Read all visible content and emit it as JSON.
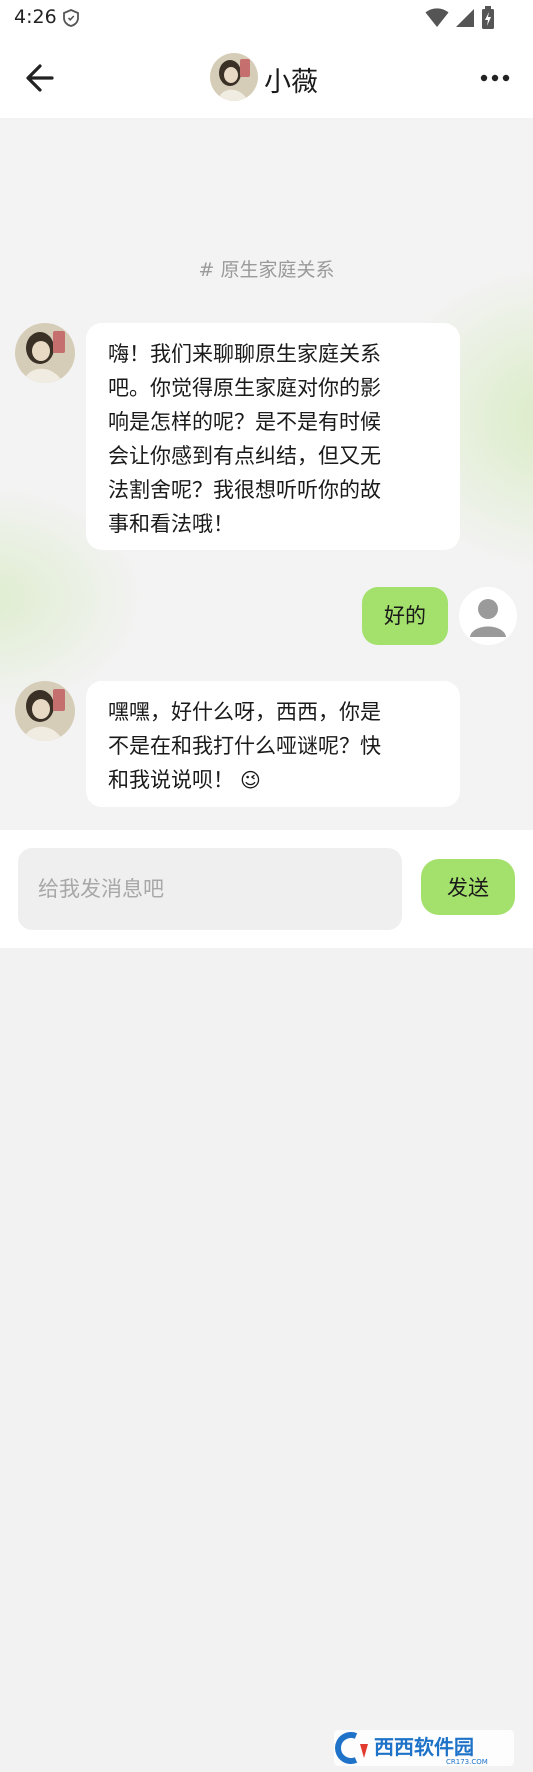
{
  "status_bar": {
    "time": "4:26",
    "icons": [
      "shield-icon",
      "wifi-icon",
      "signal-icon",
      "battery-charging-icon"
    ]
  },
  "header": {
    "back_icon": "arrow-left-icon",
    "title": "小薇",
    "more_icon": "more-horizontal-icon"
  },
  "chat": {
    "topic": "# 原生家庭关系",
    "messages": [
      {
        "sender": "小薇",
        "side": "left",
        "text": "嗨！我们来聊聊原生家庭关系\n吧。你觉得原生家庭对你的影\n响是怎样的呢？是不是有时候\n会让你感到有点纠结，但又无\n法割舍呢？我很想听听你的故\n事和看法哦！"
      },
      {
        "sender": "user",
        "side": "right",
        "text": "好的"
      },
      {
        "sender": "小薇",
        "side": "left",
        "text": "嘿嘿，好什么呀，西西，你是\n不是在和我打什么哑谜呢？快\n和我说说呗！",
        "emoji": "😉"
      }
    ]
  },
  "composer": {
    "placeholder": "给我发消息吧",
    "send_label": "发送"
  },
  "watermark": {
    "brand": "西西软件园",
    "site": "CR173.COM"
  },
  "colors": {
    "accent_green": "#a4e06c",
    "bubble_white": "#ffffff",
    "topic_gray": "#9a9a9a",
    "placeholder_gray": "#a8a8a8",
    "watermark_blue": "#1e73c8"
  }
}
